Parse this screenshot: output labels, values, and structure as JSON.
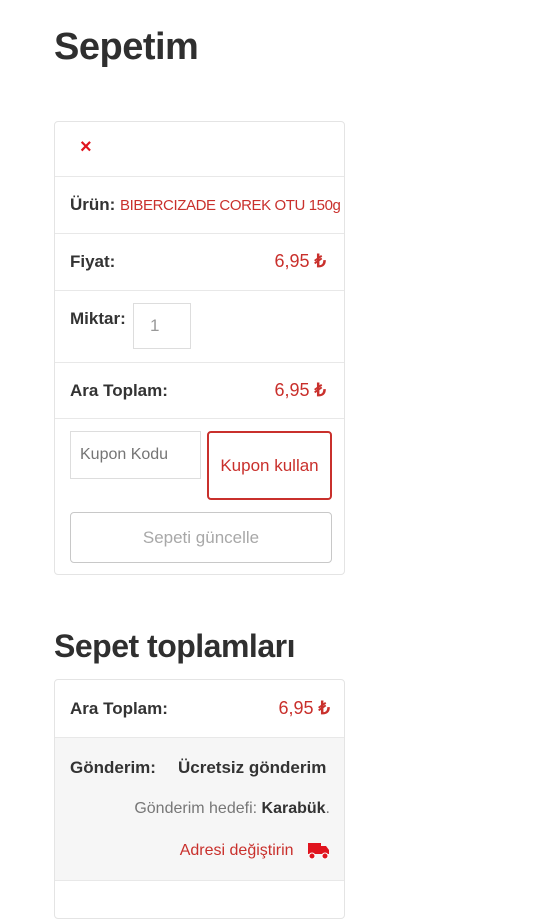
{
  "cart": {
    "title": "Sepetim",
    "remove_symbol": "×",
    "product_label": "Ürün:",
    "product_name": "BIBERCIZADE COREK OTU 150g",
    "price_label": "Fiyat:",
    "price_value": "6,95",
    "qty_label": "Miktar:",
    "qty_value": "1",
    "subtotal_label": "Ara Toplam:",
    "subtotal_value": "6,95",
    "currency": "₺",
    "coupon_placeholder": "Kupon Kodu",
    "coupon_button": "Kupon kullan",
    "update_button": "Sepeti güncelle"
  },
  "totals": {
    "title": "Sepet toplamları",
    "subtotal_label": "Ara Toplam:",
    "subtotal_value": "6,95",
    "currency": "₺",
    "shipping_label": "Gönderim:",
    "shipping_method": "Ücretsiz gönderim",
    "shipping_target_prefix": "Gönderim hedefi:",
    "shipping_target_city": "Karabük",
    "shipping_target_suffix": ".",
    "change_address": "Adresi değiştirin"
  },
  "colors": {
    "accent": "#c9302c",
    "remove": "#e0141e"
  },
  "icons": {
    "remove": "close-icon",
    "shipping": "truck-icon"
  }
}
